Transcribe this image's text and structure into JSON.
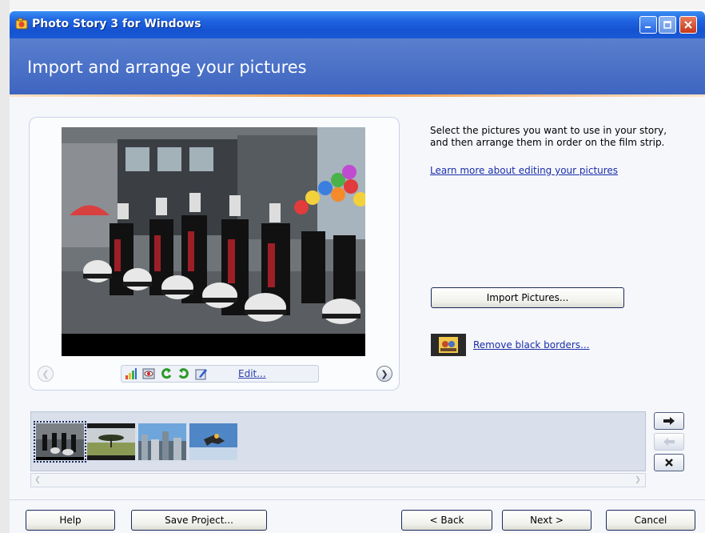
{
  "window": {
    "title": "Photo Story 3 for Windows",
    "icon": "photo-story-app-icon",
    "controls": [
      "minimize-icon",
      "maximize-icon",
      "close-icon"
    ]
  },
  "header": {
    "title": "Import and arrange your pictures"
  },
  "preview": {
    "edit_label": "Edit...",
    "tools": [
      "auto-color-icon",
      "red-eye-icon",
      "rotate-left-icon",
      "rotate-right-icon",
      "edit-icon"
    ]
  },
  "instructions": {
    "text": "Select the pictures you want to use in your story, and then arrange them in order on the film strip.",
    "learn_more_link": "Learn more about editing your pictures"
  },
  "import_button": "Import Pictures...",
  "remove_borders_link": "Remove black borders...",
  "filmstrip": {
    "thumbnails": [
      "marching-band",
      "acacia-savanna",
      "city-skyline",
      "skydiver"
    ],
    "selected_index": 0,
    "move_right_icon": "arrow-right-icon",
    "move_left_icon": "arrow-left-icon",
    "delete_icon": "delete-x-icon"
  },
  "footer": {
    "help": "Help",
    "save_project": "Save Project...",
    "back": "< Back",
    "next": "Next >",
    "cancel": "Cancel"
  },
  "colors": {
    "titlebar": "#1f63e0",
    "header": "#4a70c8",
    "accent_line": "#f29a45",
    "link": "#1a2ea8"
  }
}
